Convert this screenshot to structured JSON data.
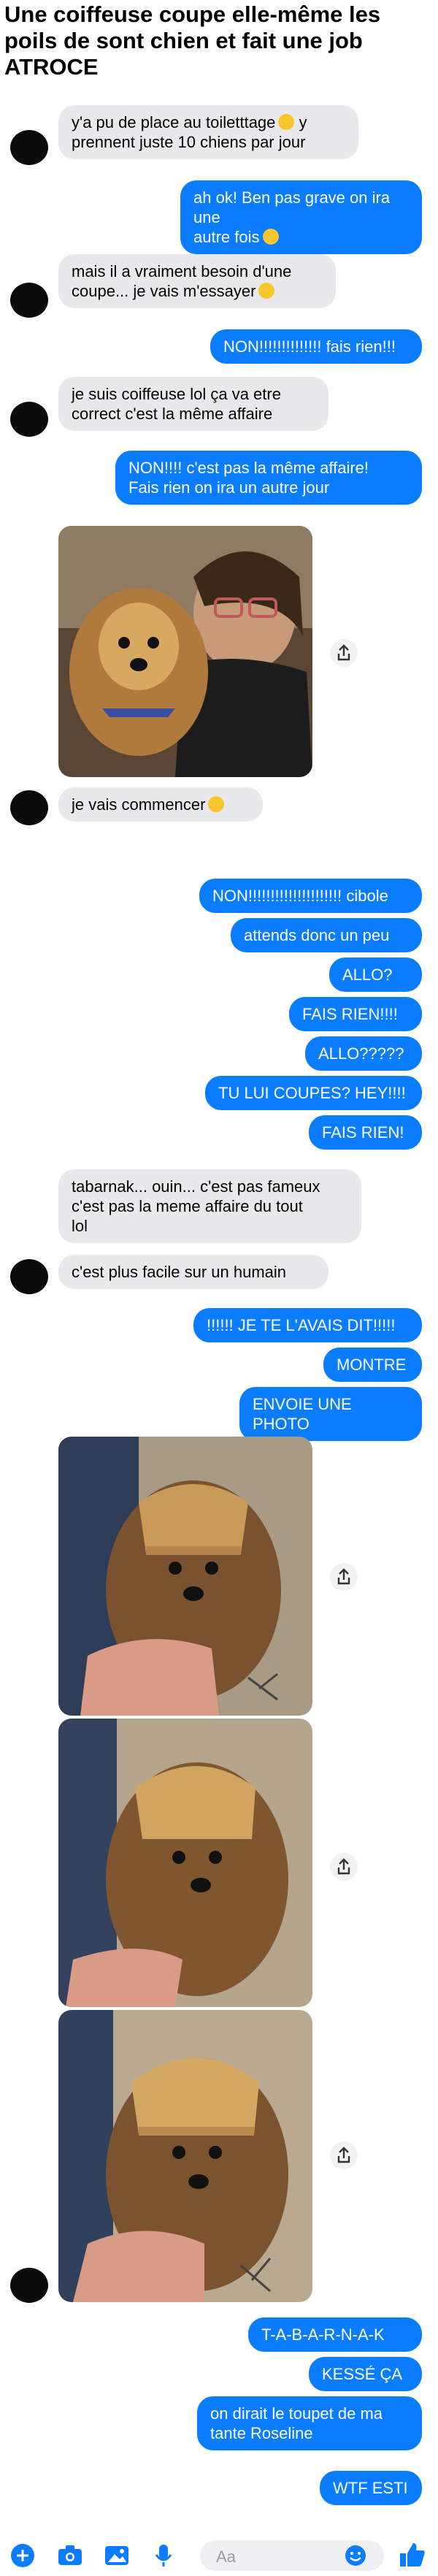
{
  "title": "Une coiffeuse coupe elle-même les poils de sont chien et fait une job ATROCE",
  "messages": [
    {
      "text": "y'a pu de place au toiletttage",
      "line2": "prennent juste 10 chiens par jour",
      "emoji_mid": "y"
    },
    {
      "text": "ah ok! Ben pas grave on ira une",
      "line2": "autre fois"
    },
    {
      "text": "mais il a vraiment besoin d'une",
      "line2": "coupe... je vais m'essayer"
    },
    {
      "text": "NON!!!!!!!!!!!!!! fais rien!!!"
    },
    {
      "text": "je suis coiffeuse lol ça va etre",
      "line2": "correct c'est la même affaire"
    },
    {
      "text": "NON!!!! c'est pas la même affaire!",
      "line2": "Fais rien on ira un autre jour"
    },
    {
      "text": "je vais commencer"
    },
    {
      "text": "NON!!!!!!!!!!!!!!!!!!!!! cibole"
    },
    {
      "text": "attends donc un peu"
    },
    {
      "text": "ALLO?"
    },
    {
      "text": "FAIS RIEN!!!!"
    },
    {
      "text": "ALLO?????"
    },
    {
      "text": "TU LUI COUPES? HEY!!!!"
    },
    {
      "text": "FAIS RIEN!"
    },
    {
      "text": "tabarnak... ouin... c'est pas fameux",
      "line2": "c'est pas la meme affaire du tout",
      "line3": "lol"
    },
    {
      "text": "c'est plus facile sur un humain"
    },
    {
      "text": "!!!!!! JE TE L'AVAIS DIT!!!!!"
    },
    {
      "text": "MONTRE"
    },
    {
      "text": "ENVOIE UNE PHOTO"
    },
    {
      "text": "T-A-B-A-R-N-A-K"
    },
    {
      "text": "KESSÉ ÇA"
    },
    {
      "text": "on dirait le toupet de ma",
      "line2": "tante Roseline"
    },
    {
      "text": "WTF ESTI"
    }
  ],
  "composer": {
    "placeholder": "Aa"
  },
  "colors": {
    "outgoing": "#0a7cff",
    "incoming": "#e9e9eb",
    "accent": "#0a7cff"
  },
  "icons": [
    "plus-icon",
    "camera-icon",
    "photo-icon",
    "mic-icon",
    "emoji-icon",
    "thumbs-up-icon",
    "share-icon"
  ]
}
